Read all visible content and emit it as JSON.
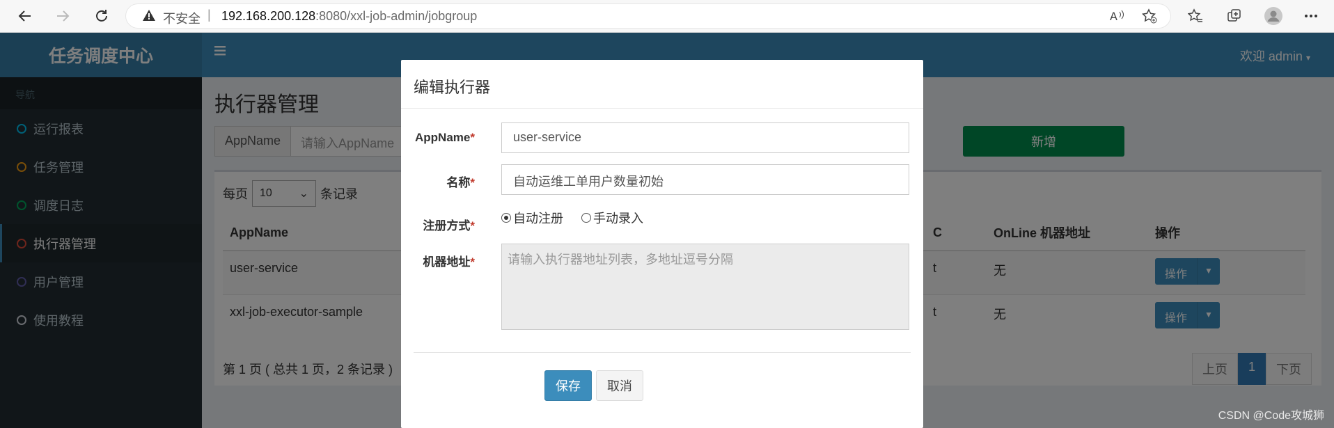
{
  "browser": {
    "not_secure": "不安全",
    "separator": "|",
    "url_host": "192.168.200.128",
    "url_rest": ":8080/xxl-job-admin/jobgroup"
  },
  "app": {
    "logo": "任务调度中心",
    "nav_header": "导航",
    "welcome": "欢迎 admin",
    "menu": [
      {
        "label": "运行报表",
        "color": "#00c0ef"
      },
      {
        "label": "任务管理",
        "color": "#f39c12"
      },
      {
        "label": "调度日志",
        "color": "#00a65a"
      },
      {
        "label": "执行器管理",
        "color": "#dd4b39"
      },
      {
        "label": "用户管理",
        "color": "#605ca8"
      },
      {
        "label": "使用教程",
        "color": "#d2d6de"
      }
    ]
  },
  "page": {
    "title": "执行器管理",
    "search_label": "AppName",
    "search_placeholder": "请输入AppName",
    "add_label": "新增",
    "per_page_prefix": "每页",
    "per_page_value": "10",
    "per_page_suffix": "条记录",
    "columns": [
      "AppName",
      "C",
      "OnLine 机器地址",
      "操作"
    ],
    "rows": [
      {
        "appname": "user-service",
        "c": "t",
        "online": "无",
        "op": "操作"
      },
      {
        "appname": "xxl-job-executor-sample",
        "c": "t",
        "online": "无",
        "op": "操作"
      }
    ],
    "page_info": "第 1 页 ( 总共 1 页，2 条记录 )",
    "pager": {
      "prev": "上页",
      "current": "1",
      "next": "下页"
    }
  },
  "modal": {
    "title": "编辑执行器",
    "appname_label": "AppName",
    "appname_value": "user-service",
    "name_label": "名称",
    "name_value": "自动运维工单用户数量初始",
    "reg_label": "注册方式",
    "reg_auto": "自动注册",
    "reg_manual": "手动录入",
    "addr_label": "机器地址",
    "addr_placeholder": "请输入执行器地址列表，多地址逗号分隔",
    "required_mark": "*",
    "save": "保存",
    "cancel": "取消"
  },
  "watermark": "CSDN @Code攻城狮"
}
